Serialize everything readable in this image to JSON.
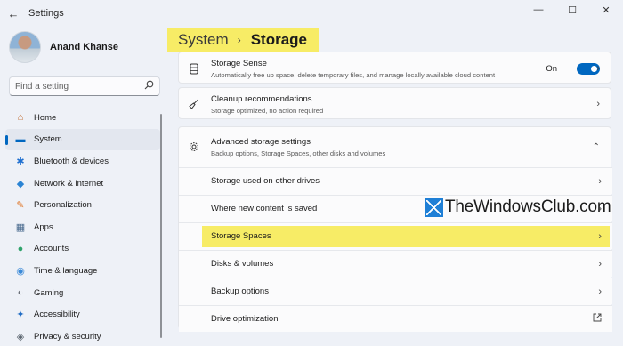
{
  "window": {
    "app_title": "Settings",
    "back_glyph": "←",
    "minimize_glyph": "—",
    "maximize_glyph": "☐",
    "close_glyph": "✕"
  },
  "profile": {
    "name": "Anand Khanse"
  },
  "search": {
    "placeholder": "Find a setting",
    "icon": "search-icon"
  },
  "nav": [
    {
      "label": "Home",
      "icon": "home-icon",
      "glyph": "⌂",
      "color": "#c0672a",
      "active": false
    },
    {
      "label": "System",
      "icon": "system-icon",
      "glyph": "▬",
      "color": "#0067c0",
      "active": true
    },
    {
      "label": "Bluetooth & devices",
      "icon": "bluetooth-icon",
      "glyph": "✱",
      "color": "#1e6fd0",
      "active": false
    },
    {
      "label": "Network & internet",
      "icon": "wifi-icon",
      "glyph": "◆",
      "color": "#2b84d4",
      "active": false
    },
    {
      "label": "Personalization",
      "icon": "brush-icon",
      "glyph": "✎",
      "color": "#e07a2e",
      "active": false
    },
    {
      "label": "Apps",
      "icon": "apps-icon",
      "glyph": "▦",
      "color": "#4a6b8f",
      "active": false
    },
    {
      "label": "Accounts",
      "icon": "accounts-icon",
      "glyph": "●",
      "color": "#2fa36b",
      "active": false
    },
    {
      "label": "Time & language",
      "icon": "globe-icon",
      "glyph": "◉",
      "color": "#3b8ad8",
      "active": false
    },
    {
      "label": "Gaming",
      "icon": "gaming-icon",
      "glyph": "◐",
      "color": "#6b7078",
      "active": false
    },
    {
      "label": "Accessibility",
      "icon": "accessibility-icon",
      "glyph": "✦",
      "color": "#1f6cc4",
      "active": false
    },
    {
      "label": "Privacy & security",
      "icon": "shield-icon",
      "glyph": "◈",
      "color": "#5c6670",
      "active": false
    }
  ],
  "breadcrumb": {
    "parent": "System",
    "separator": "›",
    "current": "Storage"
  },
  "storage_sense": {
    "title": "Storage Sense",
    "subtitle": "Automatically free up space, delete temporary files, and manage locally available cloud content",
    "toggle_label": "On",
    "toggle_on": true
  },
  "cleanup": {
    "title": "Cleanup recommendations",
    "subtitle": "Storage optimized, no action required"
  },
  "advanced": {
    "title": "Advanced storage settings",
    "subtitle": "Backup options, Storage Spaces, other disks and volumes",
    "expanded": true,
    "items": [
      {
        "label": "Storage used on other drives",
        "action": "chevron"
      },
      {
        "label": "Where new content is saved",
        "action": "chevron"
      },
      {
        "label": "Storage Spaces",
        "action": "chevron",
        "highlighted": true
      },
      {
        "label": "Disks & volumes",
        "action": "chevron"
      },
      {
        "label": "Backup options",
        "action": "chevron"
      },
      {
        "label": "Drive optimization",
        "action": "external-link"
      }
    ]
  },
  "watermark": {
    "text": "TheWindowsClub.com"
  },
  "colors": {
    "accent": "#0067c0",
    "highlight": "#f7ec66"
  }
}
